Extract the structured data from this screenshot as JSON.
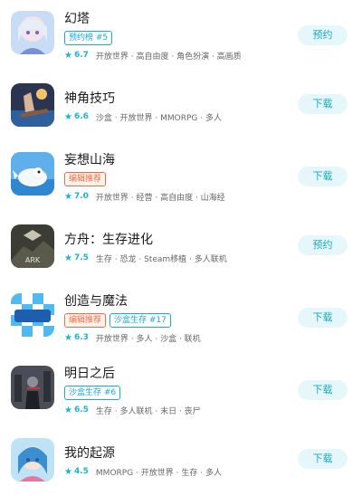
{
  "games": [
    {
      "title": "幻塔",
      "tags": [
        {
          "text": "预约榜 #5",
          "style": "blue"
        }
      ],
      "score": "6.7",
      "genres": "开放世界 · 高自由度 · 角色扮演 · 高画质",
      "button": "预约",
      "icon": "game-icon-huanta"
    },
    {
      "title": "神角技巧",
      "tags": [],
      "score": "6.6",
      "genres": "沙盒 · 开放世界 · MMORPG · 多人",
      "button": "下载",
      "icon": "game-icon-shenjiao"
    },
    {
      "title": "妄想山海",
      "tags": [
        {
          "text": "编辑推荐",
          "style": "red"
        }
      ],
      "score": "7.0",
      "genres": "开放世界 · 经营 · 高自由度 · 山海经",
      "button": "下载",
      "icon": "game-icon-wangxiang"
    },
    {
      "title": "方舟：生存进化",
      "tags": [],
      "score": "7.5",
      "genres": "生存 · 恐龙 · Steam移植 · 多人联机",
      "button": "预约",
      "icon": "game-icon-ark"
    },
    {
      "title": "创造与魔法",
      "tags": [
        {
          "text": "编辑推荐",
          "style": "red"
        },
        {
          "text": "沙盒生存 #17",
          "style": "blue"
        }
      ],
      "score": "6.3",
      "genres": "开放世界 · 多人 · 沙盒 · 联机",
      "button": "下载",
      "icon": "game-icon-chuangzao"
    },
    {
      "title": "明日之后",
      "tags": [
        {
          "text": "沙盒生存 #6",
          "style": "blue"
        }
      ],
      "score": "6.5",
      "genres": "生存 · 多人联机 · 末日 · 丧尸",
      "button": "下载",
      "icon": "game-icon-mingri"
    },
    {
      "title": "我的起源",
      "tags": [],
      "score": "4.5",
      "genres": "MMORPG · 开放世界 · 生存 · 多人",
      "button": "下载",
      "icon": "game-icon-qiyuan"
    }
  ],
  "colors": {
    "accent": "#18b5cf",
    "button_bg": "#e6f7fb",
    "tag_blue": "#1aa9d9",
    "tag_red": "#f46b45"
  }
}
